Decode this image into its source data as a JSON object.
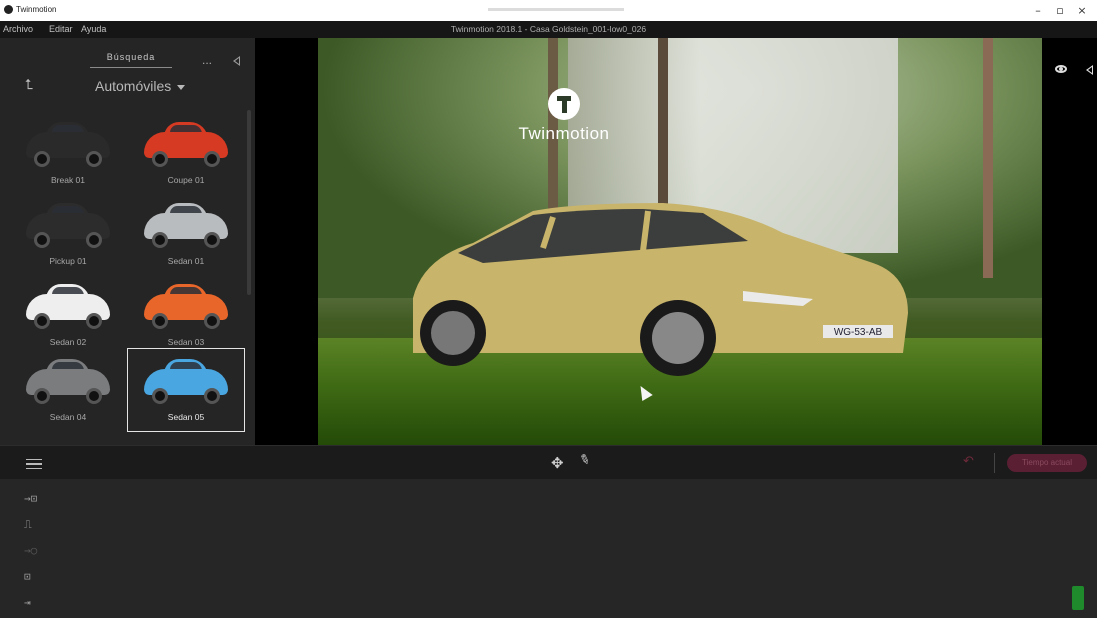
{
  "window": {
    "app_name": "Twinmotion",
    "doc_title": "Twinmotion 2018.1 - Casa Goldstein_001-low0_026",
    "controls": {
      "minimize": "–",
      "restore": "▫",
      "close": "×"
    }
  },
  "menu": {
    "items": [
      "Archivo",
      "Editar",
      "Ayuda"
    ]
  },
  "library": {
    "search_tab": "Búsqueda",
    "more": "...",
    "category": "Automóviles",
    "items": [
      {
        "label": "Break 01",
        "color": "#2a2a2a"
      },
      {
        "label": "Coupe 01",
        "color": "#d63a22"
      },
      {
        "label": "Pickup 01",
        "color": "#2c2c2c"
      },
      {
        "label": "Sedan 01",
        "color": "#b9bcbf"
      },
      {
        "label": "Sedan 02",
        "color": "#eeeeee"
      },
      {
        "label": "Sedan 03",
        "color": "#e8662a"
      },
      {
        "label": "Sedan 04",
        "color": "#7a7c7e"
      },
      {
        "label": "Sedan 05",
        "color": "#4aa6e0",
        "selected": true
      }
    ]
  },
  "viewport": {
    "logo_text": "Twinmotion",
    "plate": "WG-53-AB",
    "car_color": "#c8b46a"
  },
  "toolbar": {
    "move_icon": "✥",
    "pen_icon": "✎",
    "undo_icon": "↶",
    "play_label": "Tiempo actual"
  },
  "side_icons": [
    {
      "glyph": "→⊡",
      "name": "import-icon"
    },
    {
      "glyph": "⎍",
      "name": "settings-icon"
    },
    {
      "glyph": "→○",
      "name": "path-icon"
    },
    {
      "glyph": "⊡",
      "name": "media-icon"
    },
    {
      "glyph": "⇥",
      "name": "export-icon"
    }
  ]
}
